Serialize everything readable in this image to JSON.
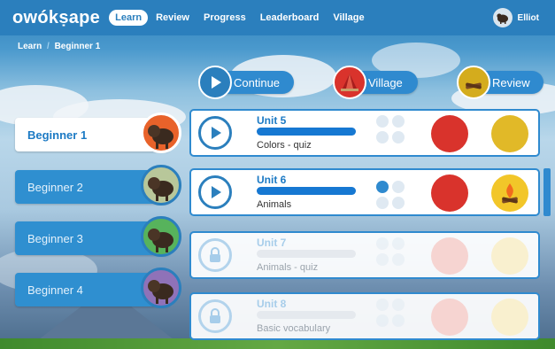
{
  "app": {
    "logo": "owókṣape"
  },
  "nav": {
    "items": [
      "Learn",
      "Review",
      "Progress",
      "Leaderboard",
      "Village"
    ],
    "active_index": 0
  },
  "user": {
    "name": "Elliot"
  },
  "breadcrumb": {
    "root": "Learn",
    "separator": "/",
    "current": "Beginner 1"
  },
  "actions": {
    "continue": {
      "label": "Continue",
      "icon": "play-icon"
    },
    "village": {
      "label": "Village",
      "icon": "village-icon"
    },
    "review": {
      "label": "Review",
      "icon": "firewood-icon"
    }
  },
  "levels": [
    {
      "label": "Beginner 1",
      "active": true,
      "badge_color": "#e8622a"
    },
    {
      "label": "Beginner 2",
      "active": false,
      "badge_color": "#b8c79a"
    },
    {
      "label": "Beginner 3",
      "active": false,
      "badge_color": "#57b35c"
    },
    {
      "label": "Beginner 4",
      "active": false,
      "badge_color": "#8f72b8"
    }
  ],
  "units": [
    {
      "title": "Unit 5",
      "subtitle": "Colors - quiz",
      "progress": 1.0,
      "locked": false
    },
    {
      "title": "Unit 6",
      "subtitle": "Animals",
      "progress": 1.0,
      "locked": false
    },
    {
      "title": "Unit 7",
      "subtitle": "Animals - quiz",
      "progress": 0.0,
      "locked": true
    },
    {
      "title": "Unit 8",
      "subtitle": "Basic vocabulary",
      "progress": 0.0,
      "locked": true
    }
  ],
  "colors": {
    "primary": "#2f8acf",
    "header": "#2b7fbd",
    "village": "#d9332c",
    "review": "#e1b928"
  }
}
